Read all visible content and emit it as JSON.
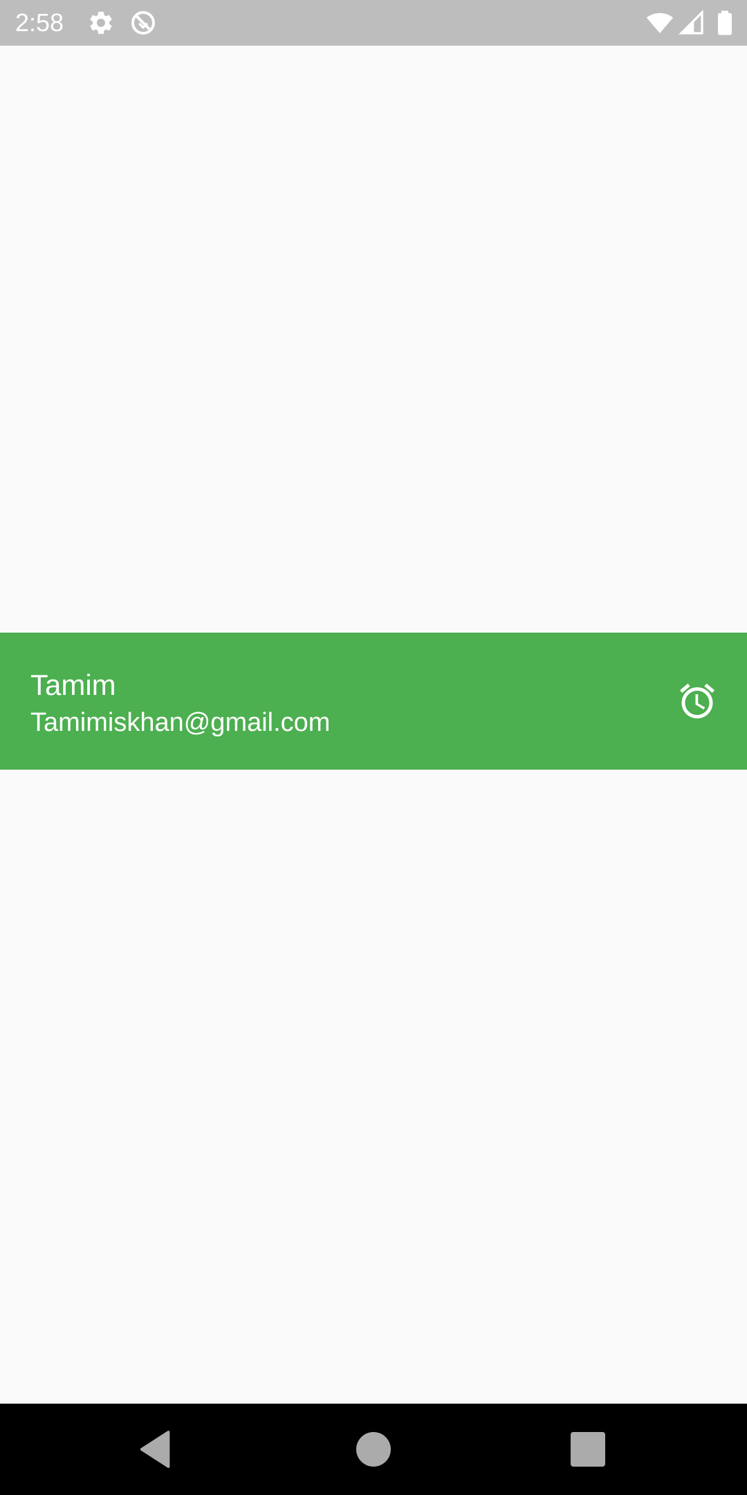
{
  "status_bar": {
    "time": "2:58",
    "left_icons": [
      "gear-icon",
      "no-disturb-icon"
    ],
    "right_icons": [
      "wifi-icon",
      "cell-signal-icon",
      "battery-icon"
    ],
    "background": "#bdbdbd"
  },
  "user_row": {
    "name": "Tamim",
    "email": "Tamimiskhan@gmail.com",
    "icon": "alarm-clock-icon",
    "background": "#4caf50"
  },
  "nav_bar": {
    "buttons": [
      "back-icon",
      "home-icon",
      "recents-icon"
    ],
    "background": "#000000"
  }
}
